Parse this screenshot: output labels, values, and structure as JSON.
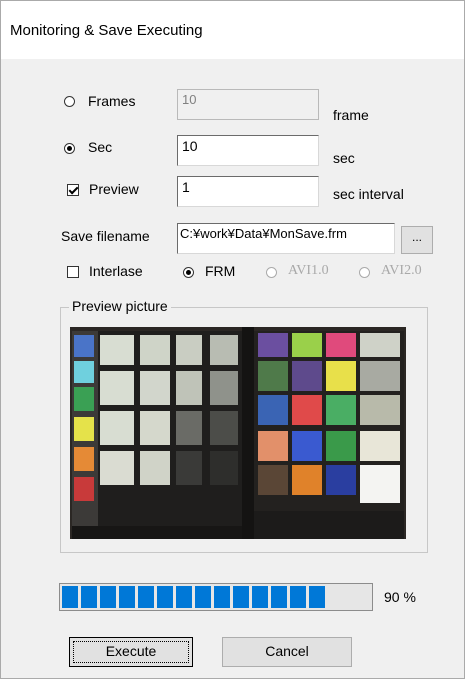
{
  "window": {
    "title": "Monitoring & Save Executing"
  },
  "frames": {
    "label": "Frames",
    "value": "10",
    "unit": "frame",
    "selected": false
  },
  "sec": {
    "label": "Sec",
    "value": "10",
    "unit": "sec",
    "selected": true
  },
  "preview": {
    "label": "Preview",
    "value": "1",
    "unit": "sec interval",
    "checked": true
  },
  "save": {
    "label": "Save filename",
    "value": "C:¥work¥Data¥MonSave.frm",
    "browse_label": "..."
  },
  "format": {
    "interlase_label": "Interlase",
    "interlase_checked": false,
    "options": [
      {
        "label": "FRM",
        "selected": true,
        "enabled": true
      },
      {
        "label": "AVI1.0",
        "selected": false,
        "enabled": false
      },
      {
        "label": "AVI2.0",
        "selected": false,
        "enabled": false
      }
    ]
  },
  "preview_picture": {
    "title": "Preview picture"
  },
  "progress": {
    "percent": 90,
    "text": "90 %",
    "color": "#0078d7"
  },
  "buttons": {
    "execute": "Execute",
    "cancel": "Cancel"
  }
}
